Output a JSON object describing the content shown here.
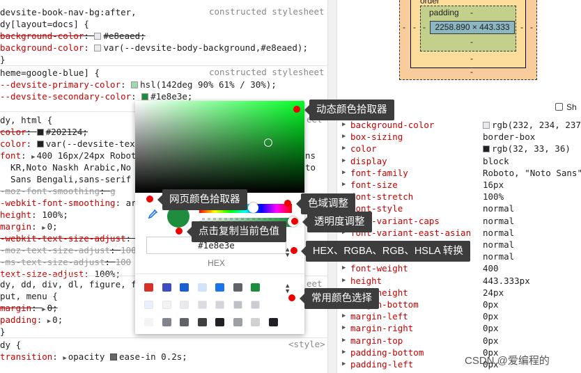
{
  "styles": {
    "rule1": {
      "selector": "devsite-book-nav-bg:after,",
      "selector2": "dy[layout=docs] {",
      "source": "constructed stylesheet",
      "decls": [
        {
          "prop": "background-color",
          "sep": ": ",
          "value": "#e8eaed;",
          "struck": true,
          "swatch": "#e8eaed"
        },
        {
          "prop": "background-color",
          "sep": ": ",
          "value": "var(--devsite-body-background,#e8eaed);",
          "struck": false,
          "swatch": "#e8eaed"
        }
      ],
      "close": "}"
    },
    "rule2": {
      "selector": "heme=google-blue] {",
      "source": "constructed stylesheet",
      "decls": [
        {
          "prop": "--devsite-primary-color",
          "sep": ": ",
          "value": "hsl(142deg 90% 61% / 30%);",
          "swatch": "#9fd9b0"
        },
        {
          "prop": "--devsite-secondary-color",
          "sep": ": ",
          "value": "#1e8e3e;",
          "swatch": "#1e8e3e"
        }
      ]
    },
    "rule3": {
      "selector": "dy, html {",
      "source": "constructed stylesheet",
      "lines": [
        {
          "prop": "color",
          "value": "#202124;",
          "struck": true,
          "swatch": "#202124"
        },
        {
          "prop": "color",
          "value": "var(--devsite-tex",
          "swatch": "#202124"
        },
        {
          "prop": "font",
          "value": "400 16px/24px Robot",
          "tri": true,
          "tail": "ns"
        },
        {
          "text": "  KR,Noto Naskh Arabic,No",
          "tail": "to"
        },
        {
          "text": "  Sans Bengali,sans-serif"
        },
        {
          "prop": "-moz-font-smoothing",
          "value": "g",
          "struck": true,
          "gray": true
        },
        {
          "prop": "-webkit-font-smoothing",
          "value": "ar"
        },
        {
          "prop": "height",
          "value": "100%;"
        },
        {
          "prop": "margin",
          "value": "0;",
          "tri": true
        },
        {
          "prop": "-webkit-text-size-adjust",
          "value": "",
          "struck": true
        },
        {
          "prop": "-moz-text-size-adjust",
          "value": "100",
          "struck": true,
          "gray": true
        },
        {
          "prop": "-ms-text-size-adjust",
          "value": "100",
          "struck": true,
          "gray": true
        },
        {
          "prop": "text-size-adjust",
          "value": "100%;"
        }
      ]
    },
    "rule4": {
      "selector": "dy, dd, div, dl, figure, f",
      "selector2": "put, menu {",
      "source": "eet",
      "lines": [
        {
          "prop": "margin",
          "value": "0;",
          "tri": true,
          "struck": true
        },
        {
          "prop": "padding",
          "value": "0;",
          "tri": true
        }
      ],
      "close": "}"
    },
    "rule5": {
      "selector": "dy {",
      "source": "<style>",
      "lines": [
        {
          "prop": "transition",
          "value": "opacity ",
          "tri": true,
          "easing": "ease-in 0.2s;"
        }
      ]
    }
  },
  "box_model": {
    "padding_label": "padding",
    "dash": "-",
    "content": "2258.890 × 443.333",
    "border_label": "order"
  },
  "computed": {
    "show_all_label": "Sh",
    "rows": [
      {
        "name": "background-color",
        "value": "rgb(232, 234, 237",
        "swatch": "#e8eaed"
      },
      {
        "name": "box-sizing",
        "value": "border-box"
      },
      {
        "name": "color",
        "value": "rgb(32, 33, 36)",
        "swatch": "#202124"
      },
      {
        "name": "display",
        "value": "block"
      },
      {
        "name": "font-family",
        "value": "Roboto, \"Noto Sans\""
      },
      {
        "name": "font-size",
        "value": "16px"
      },
      {
        "name": "font-stretch",
        "value": "100%"
      },
      {
        "name": "font-style",
        "value": "normal"
      },
      {
        "name": "font-variant-caps",
        "value": "normal"
      },
      {
        "name": "font-variant-east-asian",
        "value": "normal"
      },
      {
        "name": "font-variant-ligatures",
        "value": "normal"
      },
      {
        "name": "font-variant-numeric",
        "value": "normal"
      },
      {
        "name": "font-weight",
        "value": "400"
      },
      {
        "name": "height",
        "value": "443.333px"
      },
      {
        "name": "line-height",
        "value": "24px"
      },
      {
        "name": "margin-bottom",
        "value": "0px"
      },
      {
        "name": "margin-left",
        "value": "0px"
      },
      {
        "name": "margin-right",
        "value": "0px"
      },
      {
        "name": "margin-top",
        "value": "0px"
      },
      {
        "name": "padding-bottom",
        "value": "0px"
      },
      {
        "name": "padding-left",
        "value": "0px"
      }
    ]
  },
  "picker": {
    "current_color": "#1e8e3e",
    "hex_value": "#1e8e3e",
    "format_label": "HEX",
    "palette_row1": [
      "#d93025",
      "#3c4ec2",
      "#1a5fd0",
      "#d2e3fc",
      "#1a73e8",
      "#5f6368",
      "#1e8e3e"
    ],
    "palette_row2": [
      "#e8f0fe",
      "#f1f3f4",
      "#e8eaed",
      "#dadce0",
      "#d2d4d7",
      "#bdc1c6",
      "#c9ccd0"
    ],
    "palette_row3": [
      "#f4f4f4",
      "#80868b",
      "#5f6368",
      "#3c4043",
      "#202124",
      "#9aa0a6",
      "#cfd1d4",
      "#202124"
    ]
  },
  "callouts": {
    "dynamic_picker": "动态颜色拾取器",
    "page_picker": "网页颜色拾取器",
    "gamut": "色域调整",
    "opacity": "透明度调整",
    "copy": "点击复制当前色值",
    "format_switch": "HEX、RGBA、RGB、HSLA 转换",
    "common_colors": "常用颜色选择"
  },
  "watermark": "CSDN @爱编程的",
  "colors": {
    "property": "#c80000",
    "callout_bg": "#3d3d3d",
    "marker": "#e00000"
  }
}
